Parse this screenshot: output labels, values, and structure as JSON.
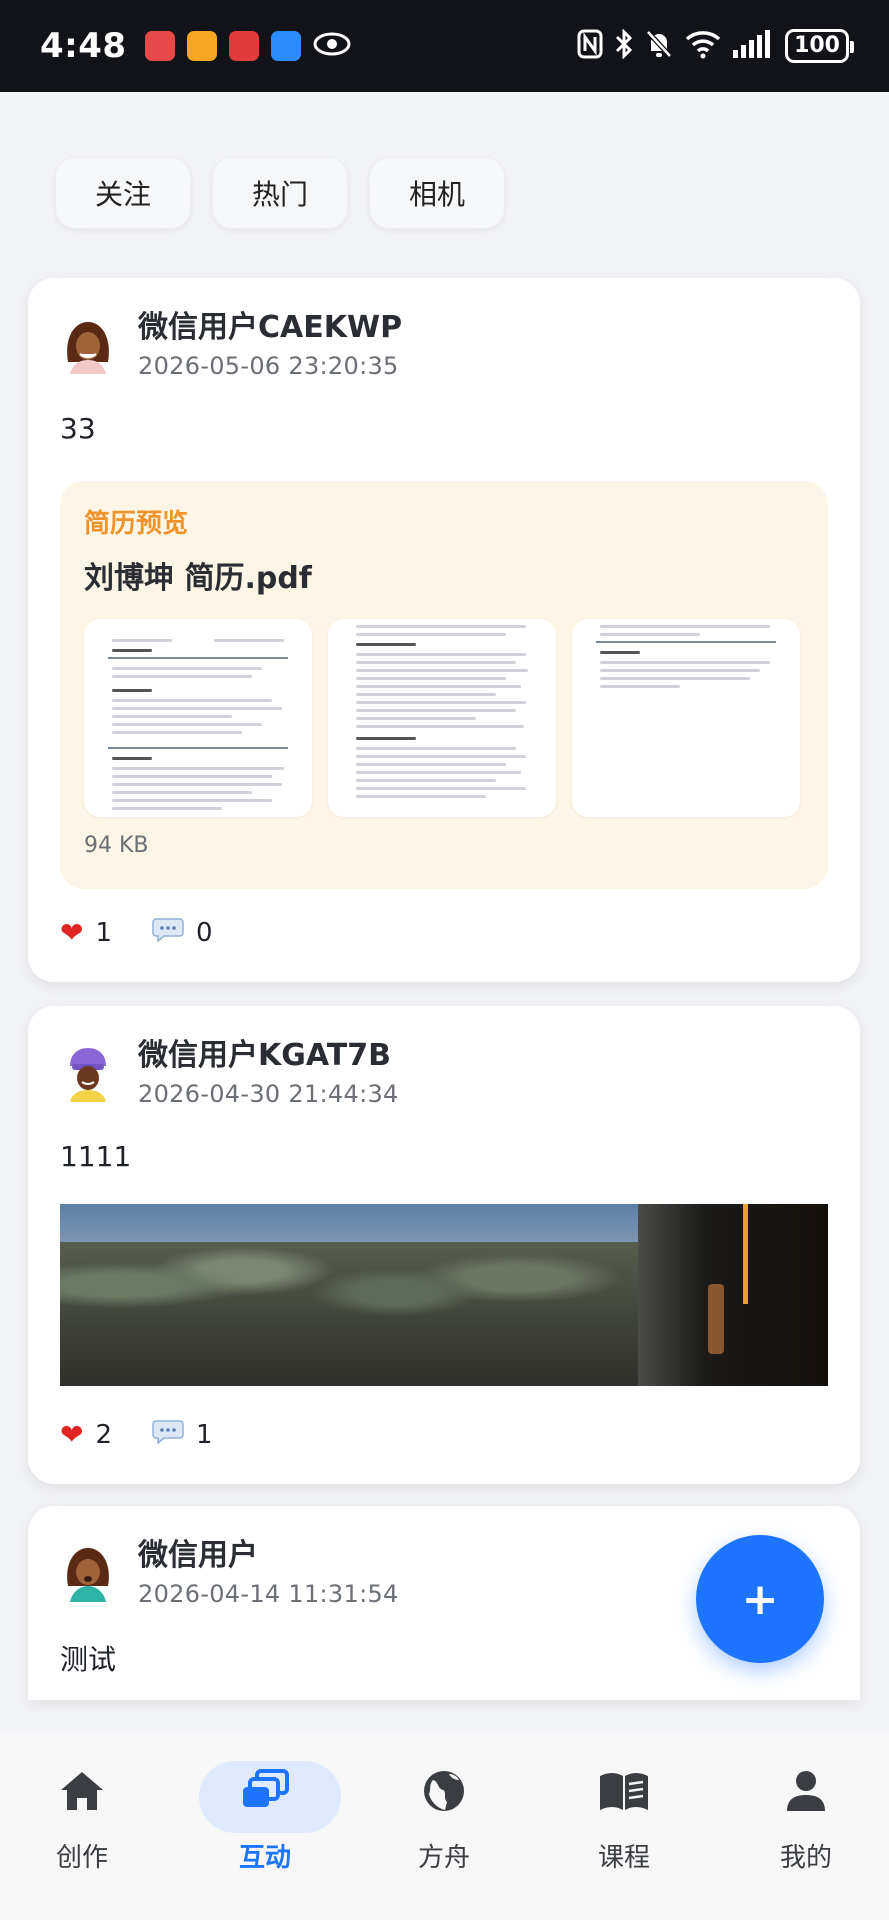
{
  "status_bar": {
    "time": "4:48",
    "battery": "100",
    "app_icon_colors": [
      "#e84a4a",
      "#f5a623",
      "#e23b3b",
      "#2b8cff"
    ]
  },
  "filters": [
    {
      "label": "关注"
    },
    {
      "label": "热门"
    },
    {
      "label": "相机"
    }
  ],
  "posts": [
    {
      "username": "微信用户CAEKWP",
      "timestamp": "2026-05-06 23:20:35",
      "text": "33",
      "attachment": {
        "label": "简历预览",
        "file_name": "刘博坤 简历.pdf",
        "file_size": "94 KB"
      },
      "likes": "1",
      "comments": "0"
    },
    {
      "username": "微信用户KGAT7B",
      "timestamp": "2026-04-30 21:44:34",
      "text": "1111",
      "likes": "2",
      "comments": "1"
    },
    {
      "username": "微信用户",
      "timestamp": "2026-04-14 11:31:54",
      "text": "测试"
    }
  ],
  "fab": {
    "label": "+"
  },
  "bottom_nav": [
    {
      "label": "创作",
      "icon": "home-icon"
    },
    {
      "label": "互动",
      "icon": "interaction-icon",
      "active": true
    },
    {
      "label": "方舟",
      "icon": "globe-icon"
    },
    {
      "label": "课程",
      "icon": "book-icon"
    },
    {
      "label": "我的",
      "icon": "person-icon"
    }
  ],
  "colors": {
    "accent": "#1d74ff",
    "resume_label": "#f0932b",
    "heart": "#e02424"
  }
}
